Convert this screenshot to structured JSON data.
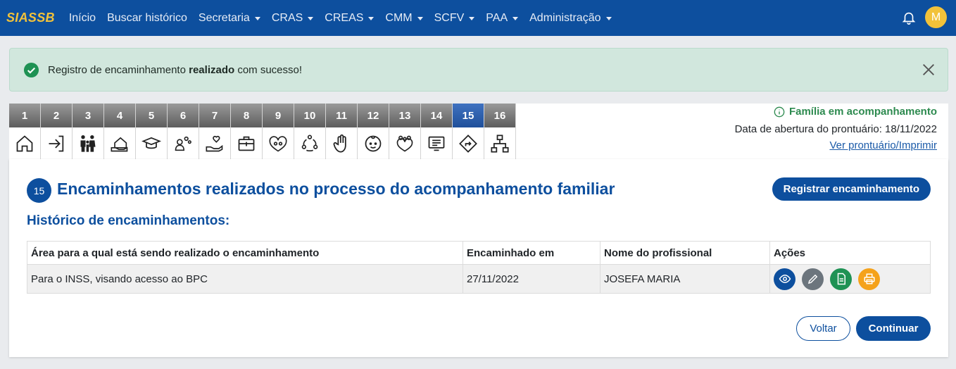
{
  "app": {
    "brand": "SIASSB",
    "avatar_initial": "M"
  },
  "nav": {
    "items": [
      {
        "label": "Início",
        "dropdown": false
      },
      {
        "label": "Buscar histórico",
        "dropdown": false
      },
      {
        "label": "Secretaria",
        "dropdown": true
      },
      {
        "label": "CRAS",
        "dropdown": true
      },
      {
        "label": "CREAS",
        "dropdown": true
      },
      {
        "label": "CMM",
        "dropdown": true
      },
      {
        "label": "SCFV",
        "dropdown": true
      },
      {
        "label": "PAA",
        "dropdown": true
      },
      {
        "label": "Administração",
        "dropdown": true
      }
    ]
  },
  "alert": {
    "text_before": "Registro de encaminhamento ",
    "text_bold": "realizado",
    "text_after": " com sucesso!"
  },
  "tabs": [
    {
      "num": "1",
      "icon": "home-icon"
    },
    {
      "num": "2",
      "icon": "sign-in-icon"
    },
    {
      "num": "3",
      "icon": "family-icon"
    },
    {
      "num": "4",
      "icon": "house-hand-icon"
    },
    {
      "num": "5",
      "icon": "graduation-cap-icon"
    },
    {
      "num": "6",
      "icon": "person-gears-icon"
    },
    {
      "num": "7",
      "icon": "hand-heart-icon"
    },
    {
      "num": "8",
      "icon": "medical-kit-icon"
    },
    {
      "num": "9",
      "icon": "people-heart-icon"
    },
    {
      "num": "10",
      "icon": "community-icon"
    },
    {
      "num": "11",
      "icon": "hand-stop-icon"
    },
    {
      "num": "12",
      "icon": "child-face-icon"
    },
    {
      "num": "13",
      "icon": "family-heart-icon"
    },
    {
      "num": "14",
      "icon": "presentation-icon"
    },
    {
      "num": "15",
      "icon": "route-sign-icon",
      "active": true
    },
    {
      "num": "16",
      "icon": "hierarchy-icon"
    }
  ],
  "info": {
    "status": "Família em acompanhamento",
    "opening_date": "Data de abertura do prontuário: 18/11/2022",
    "view_link": "Ver prontuário/Imprimir"
  },
  "card": {
    "step": "15",
    "title": "Encaminhamentos realizados no processo do acompanhamento familiar",
    "register_button": "Registrar encaminhamento",
    "subtitle": "Histórico de encaminhamentos:",
    "table": {
      "headers": [
        "Área para a qual está sendo realizado o encaminhamento",
        "Encaminhado em",
        "Nome do profissional",
        "Ações"
      ],
      "rows": [
        {
          "area": "Para o INSS, visando acesso ao BPC",
          "date": "27/11/2022",
          "professional": "JOSEFA MARIA"
        }
      ]
    },
    "back_button": "Voltar",
    "next_button": "Continuar"
  },
  "colors": {
    "primary": "#0d4f9e",
    "brand": "#f2c23a",
    "success": "#2d8a4f",
    "alert_bg": "#d1e7dd"
  }
}
